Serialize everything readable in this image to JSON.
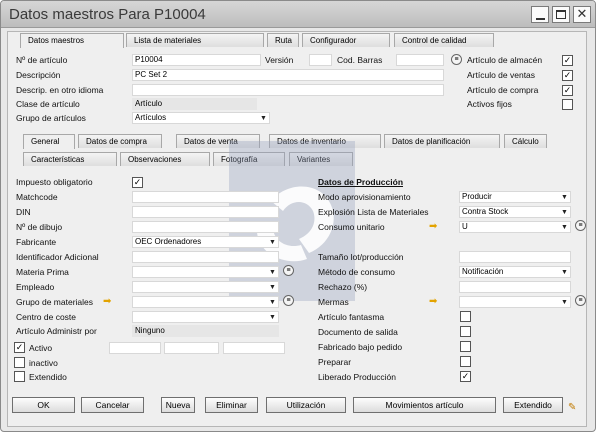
{
  "window": {
    "title": "Datos maestros Para P10004"
  },
  "top_tabs": [
    "Datos maestros",
    "Lista de materiales",
    "Ruta",
    "Configurador",
    "Control de calidad"
  ],
  "header": {
    "num_articulo_label": "Nº de artículo",
    "num_articulo_value": "P10004",
    "version_label": "Versión",
    "cod_barras_label": "Cod. Barras",
    "descripcion_label": "Descripción",
    "descripcion_value": "PC Set 2",
    "descrip_otro_label": "Descrip. en otro idioma",
    "clase_label": "Clase de artículo",
    "clase_value": "Artículo",
    "grupo_label": "Grupo de artículos",
    "grupo_value": "Artículos",
    "flags": [
      {
        "label": "Artículo de almacén",
        "checked": true
      },
      {
        "label": "Artículo de ventas",
        "checked": true
      },
      {
        "label": "Artículo de compra",
        "checked": true
      },
      {
        "label": "Activos fijos",
        "checked": false
      }
    ]
  },
  "tabs_row1": [
    "General",
    "Datos de compra",
    "Datos de venta",
    "Datos de inventario",
    "Datos de planificación",
    "Cálculo"
  ],
  "tabs_row2": [
    "Características",
    "Observaciones",
    "Fotografía",
    "Variantes"
  ],
  "left": {
    "impuesto_label": "Impuesto obligatorio",
    "impuesto_checked": true,
    "matchcode": "Matchcode",
    "din": "DIN",
    "dibujo": "Nº de dibujo",
    "fabricante_label": "Fabricante",
    "fabricante_value": "OEC Ordenadores",
    "ident_adicional": "Identificador Adicional",
    "materia_prima": "Materia Prima",
    "empleado": "Empleado",
    "grupo_materiales": "Grupo de materiales",
    "centro_coste": "Centro de coste",
    "admin_por_label": "Artículo Administr por",
    "admin_por_value": "Ninguno",
    "activo": "Activo",
    "activo_checked": true,
    "inactivo": "inactivo",
    "extendido": "Extendido"
  },
  "produccion": {
    "heading": "Datos de Producción",
    "modo_label": "Modo aprovisionamiento",
    "modo_value": "Producir",
    "explosion_label": "Explosión Lista de Materiales",
    "explosion_value": "Contra Stock",
    "consumo_unit_label": "Consumo unitario",
    "consumo_unit_value": "U",
    "tamano_label": "Tamaño lot/producción",
    "metodo_label": "Método de consumo",
    "metodo_value": "Notificación",
    "rechazo_label": "Rechazo (%)",
    "mermas_label": "Mermas",
    "checks": [
      {
        "label": "Artículo fantasma",
        "checked": false
      },
      {
        "label": "Documento de salida",
        "checked": false
      },
      {
        "label": "Fabricado bajo pedido",
        "checked": false
      },
      {
        "label": "Preparar",
        "checked": false
      },
      {
        "label": "Liberado Producción",
        "checked": true
      }
    ]
  },
  "buttons": [
    "OK",
    "Cancelar",
    "Nueva",
    "Eliminar",
    "Utilización",
    "Movimientos artículo",
    "Extendido"
  ]
}
